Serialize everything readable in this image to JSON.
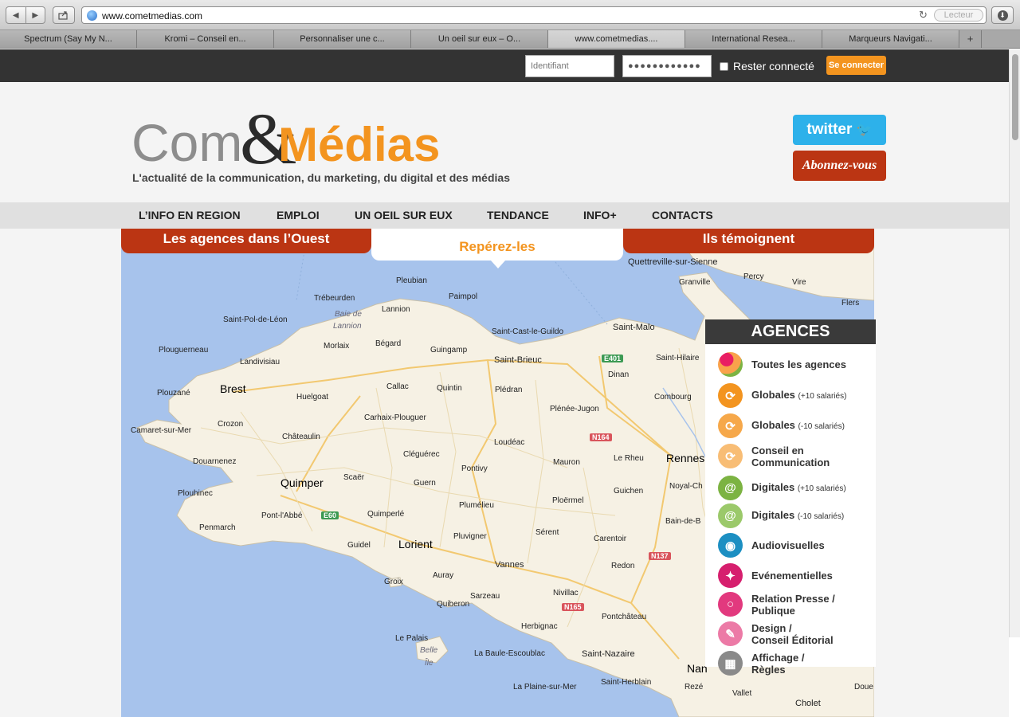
{
  "browser": {
    "url": "www.cometmedias.com",
    "reader_label": "Lecteur",
    "tabs": [
      {
        "label": "Spectrum (Say My N..."
      },
      {
        "label": "Kromi – Conseil en..."
      },
      {
        "label": "Personnaliser une c..."
      },
      {
        "label": "Un oeil sur eux – O..."
      },
      {
        "label": "www.cometmedias...."
      },
      {
        "label": "International Resea..."
      },
      {
        "label": "Marqueurs Navigati..."
      }
    ]
  },
  "login": {
    "username_placeholder": "Identifiant",
    "password_value": "●●●●●●●●●●●●",
    "remember_label": "Rester connecté",
    "submit_label": "Se connecter"
  },
  "header": {
    "logo_com": "Com",
    "logo_amp": "&",
    "logo_medias": "Médias",
    "tagline": "L'actualité de la communication, du marketing, du digital et des médias",
    "twitter_label": "twitter",
    "subscribe_label": "Abonnez-vous"
  },
  "menu": {
    "items": [
      {
        "label": "L’INFO EN REGION"
      },
      {
        "label": "EMPLOI"
      },
      {
        "label": "UN OEIL SUR EUX"
      },
      {
        "label": "TENDANCE"
      },
      {
        "label": "INFO+"
      },
      {
        "label": "CONTACTS"
      }
    ]
  },
  "section_tabs": {
    "left": "Les agences dans l’Ouest",
    "middle": "Repérez-les",
    "right": "Ils témoignent"
  },
  "map": {
    "places": [
      {
        "name": "Quettreville-sur-Sienne"
      },
      {
        "name": "Pleubian"
      },
      {
        "name": "Granville"
      },
      {
        "name": "Percy"
      },
      {
        "name": "Vire"
      },
      {
        "name": "Flers"
      },
      {
        "name": "Trébeurden"
      },
      {
        "name": "Paimpol"
      },
      {
        "name": "Lannion"
      },
      {
        "name": "Baie de"
      },
      {
        "name": "Lannion"
      },
      {
        "name": "Saint-Pol-de-Léon"
      },
      {
        "name": "Saint-Cast-le-Guildo"
      },
      {
        "name": "Saint-Malo"
      },
      {
        "name": "Plouguerneau"
      },
      {
        "name": "Morlaix"
      },
      {
        "name": "Bégard"
      },
      {
        "name": "Guingamp"
      },
      {
        "name": "Landivisiau"
      },
      {
        "name": "Saint-Brieuc"
      },
      {
        "name": "Dinan"
      },
      {
        "name": "Saint-Hilaire"
      },
      {
        "name": "Brest"
      },
      {
        "name": "Plouzané"
      },
      {
        "name": "Huelgoat"
      },
      {
        "name": "Callac"
      },
      {
        "name": "Quintin"
      },
      {
        "name": "Plédran"
      },
      {
        "name": "Combourg"
      },
      {
        "name": "Plénée-Jugon"
      },
      {
        "name": "Carhaix-Plouguer"
      },
      {
        "name": "Crozon"
      },
      {
        "name": "Camaret-sur-Mer"
      },
      {
        "name": "Châteaulin"
      },
      {
        "name": "Loudéac"
      },
      {
        "name": "Le Rheu"
      },
      {
        "name": "Rennes"
      },
      {
        "name": "Cléguérec"
      },
      {
        "name": "Mauron"
      },
      {
        "name": "Douarnenez"
      },
      {
        "name": "Pontivy"
      },
      {
        "name": "Quimper"
      },
      {
        "name": "Scaër"
      },
      {
        "name": "Guern"
      },
      {
        "name": "Guichen"
      },
      {
        "name": "Noyal-Ch"
      },
      {
        "name": "Plouhinec"
      },
      {
        "name": "Plumélieu"
      },
      {
        "name": "Ploërmel"
      },
      {
        "name": "Quimperlé"
      },
      {
        "name": "Pont-l'Abbé"
      },
      {
        "name": "Bain-de-B"
      },
      {
        "name": "Penmarch"
      },
      {
        "name": "Sérent"
      },
      {
        "name": "Pluvigner"
      },
      {
        "name": "Carentoir"
      },
      {
        "name": "Guidel"
      },
      {
        "name": "Lorient"
      },
      {
        "name": "Vannes"
      },
      {
        "name": "Redon"
      },
      {
        "name": "Auray"
      },
      {
        "name": "Groix"
      },
      {
        "name": "Nivillac"
      },
      {
        "name": "Sarzeau"
      },
      {
        "name": "Quiberon"
      },
      {
        "name": "Pontchâteau"
      },
      {
        "name": "Herbignac"
      },
      {
        "name": "Le Palais"
      },
      {
        "name": "Belle"
      },
      {
        "name": "Île"
      },
      {
        "name": "La Baule-Escoublac"
      },
      {
        "name": "Saint-Nazaire"
      },
      {
        "name": "Nan"
      },
      {
        "name": "Saint-Herblain"
      },
      {
        "name": "Rezé"
      },
      {
        "name": "Doue"
      },
      {
        "name": "La Plaine-sur-Mer"
      },
      {
        "name": "Vallet"
      },
      {
        "name": "Cholet"
      }
    ],
    "roads": [
      "E401",
      "N164",
      "E60",
      "N137",
      "N165"
    ]
  },
  "agences": {
    "title": "AGENCES",
    "items": [
      {
        "label": "Toutes les agences",
        "sub": "",
        "icon": "all-agencies-icon",
        "color": "#e8a13a"
      },
      {
        "label": "Globales",
        "sub": "(+10 salariés)",
        "icon": "global-plus-icon",
        "color": "#f3941f"
      },
      {
        "label": "Globales",
        "sub": "(-10 salariés)",
        "icon": "global-minus-icon",
        "color": "#f6a84a"
      },
      {
        "label": "Conseil en",
        "label2": "Communication",
        "sub": "",
        "icon": "conseil-icon",
        "color": "#f8bd75"
      },
      {
        "label": "Digitales",
        "sub": "(+10 salariés)",
        "icon": "digital-plus-icon",
        "color": "#7cb342"
      },
      {
        "label": "Digitales",
        "sub": "(-10 salariés)",
        "icon": "digital-minus-icon",
        "color": "#9bc96a"
      },
      {
        "label": "Audiovisuelles",
        "sub": "",
        "icon": "audiovisual-icon",
        "color": "#1c8fc2"
      },
      {
        "label": "Evénementielles",
        "sub": "",
        "icon": "event-icon",
        "color": "#d61f6e"
      },
      {
        "label": "Relation Presse /",
        "label2": "Publique",
        "sub": "",
        "icon": "press-icon",
        "color": "#e2397e"
      },
      {
        "label": "Design /",
        "label2": "Conseil Éditorial",
        "sub": "",
        "icon": "design-icon",
        "color": "#ec7aa6"
      },
      {
        "label": "Affichage /",
        "label2": "Règles",
        "sub": "",
        "icon": "display-icon",
        "color": "#8a8a8a"
      }
    ]
  },
  "colors": {
    "accent_orange": "#f3941f",
    "brand_red": "#bb3513",
    "dark_bar": "#333333",
    "twitter_blue": "#2db1ea",
    "sea": "#a7c3ec",
    "land": "#f6f1e4"
  }
}
